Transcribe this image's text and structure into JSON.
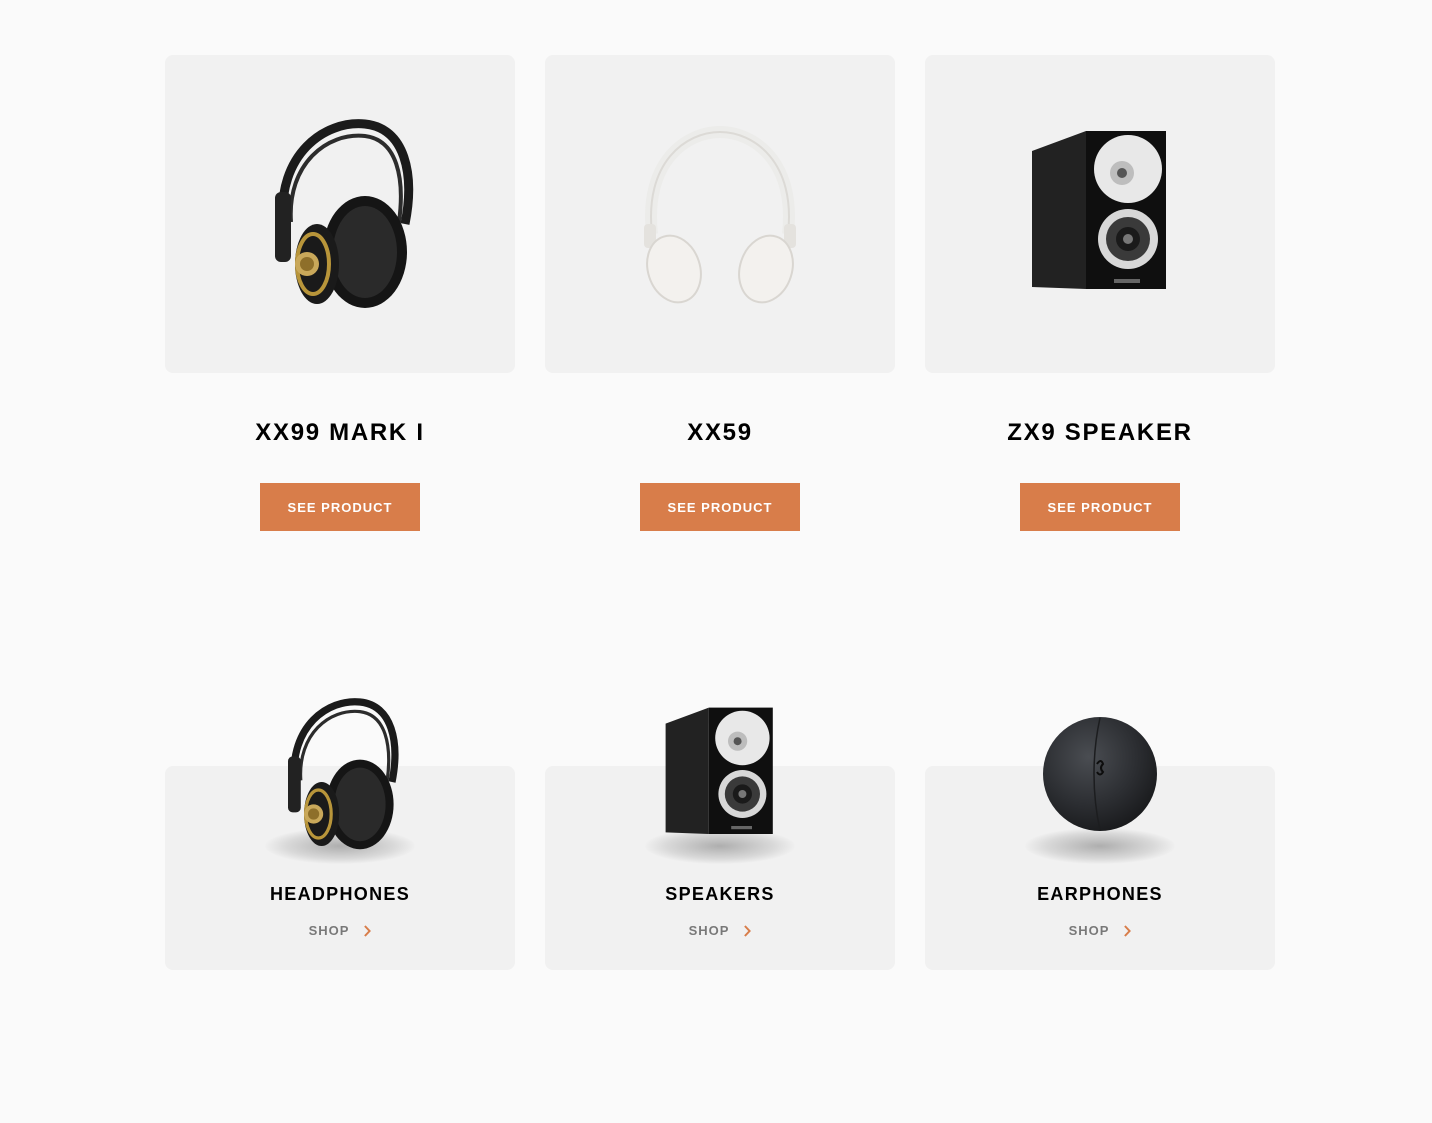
{
  "products": [
    {
      "name": "XX99 MARK I",
      "button_label": "SEE PRODUCT"
    },
    {
      "name": "XX59",
      "button_label": "SEE PRODUCT"
    },
    {
      "name": "ZX9 SPEAKER",
      "button_label": "SEE PRODUCT"
    }
  ],
  "categories": [
    {
      "name": "HEADPHONES",
      "link_label": "SHOP"
    },
    {
      "name": "SPEAKERS",
      "link_label": "SHOP"
    },
    {
      "name": "EARPHONES",
      "link_label": "SHOP"
    }
  ],
  "colors": {
    "accent": "#d87d4a",
    "card_background": "#f1f1f1",
    "page_background": "#fafafa"
  },
  "icons": {
    "product_images": [
      "black-headphones-icon",
      "white-headphones-icon",
      "speaker-icon"
    ],
    "category_images": [
      "black-headphones-icon",
      "speaker-icon",
      "earphones-case-icon"
    ],
    "shop_arrow": "chevron-right-icon"
  }
}
